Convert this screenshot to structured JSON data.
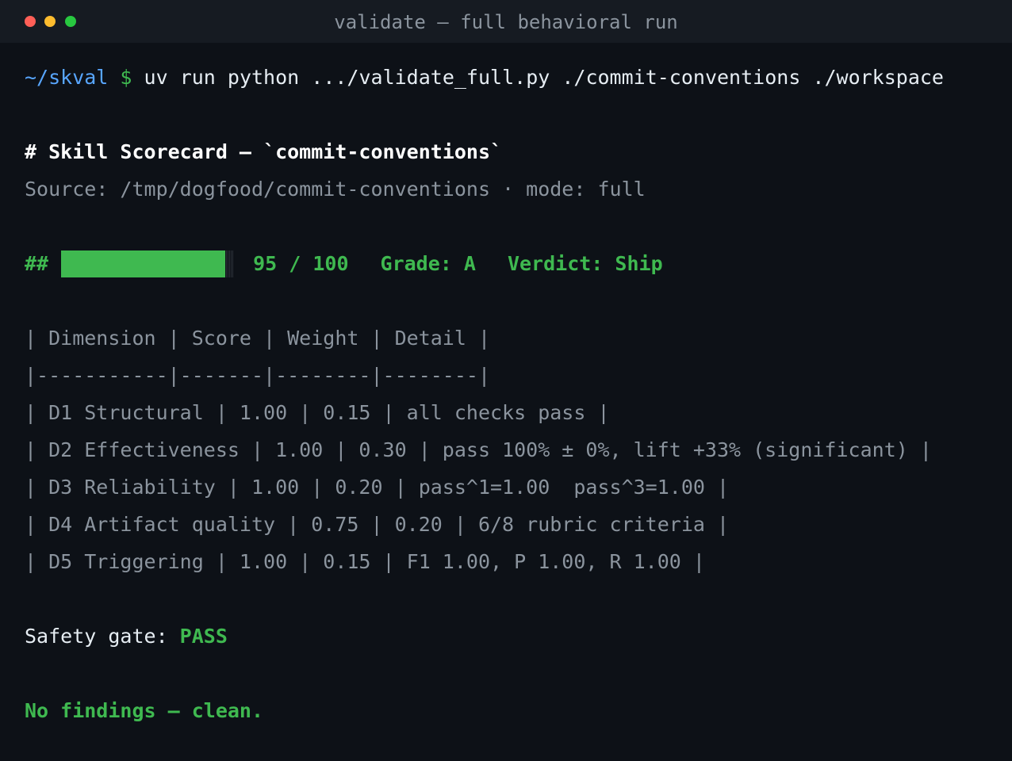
{
  "window": {
    "title": "validate — full behavioral run"
  },
  "command": {
    "path": "~/skval",
    "prompt": "$",
    "text": "uv run python .../validate_full.py ./commit-conventions ./workspace"
  },
  "scorecard": {
    "heading": "# Skill Scorecard — `commit-conventions`",
    "source": "Source: /tmp/dogfood/commit-conventions · mode: full",
    "bar_prefix": "##",
    "score_fraction": 0.95,
    "score": "95 / 100",
    "grade": "Grade: A",
    "verdict": "Verdict: Ship"
  },
  "table": {
    "header": "| Dimension | Score | Weight | Detail |",
    "separator": "|-----------|-------|--------|--------|",
    "rows": [
      "| D1 Structural | 1.00 | 0.15 | all checks pass |",
      "| D2 Effectiveness | 1.00 | 0.30 | pass 100% ± 0%, lift +33% (significant) |",
      "| D3 Reliability | 1.00 | 0.20 | pass^1=1.00  pass^3=1.00 |",
      "| D4 Artifact quality | 0.75 | 0.20 | 6/8 rubric criteria |",
      "| D5 Triggering | 1.00 | 0.15 | F1 1.00, P 1.00, R 1.00 |"
    ]
  },
  "safety": {
    "label": "Safety gate: ",
    "value": "PASS"
  },
  "findings": {
    "text": "No findings — clean."
  },
  "colors": {
    "background": "#0d1117",
    "titlebar": "#161b22",
    "accent_green": "#3fb950",
    "path_blue": "#58a6ff",
    "dim_text": "#8b949e"
  }
}
